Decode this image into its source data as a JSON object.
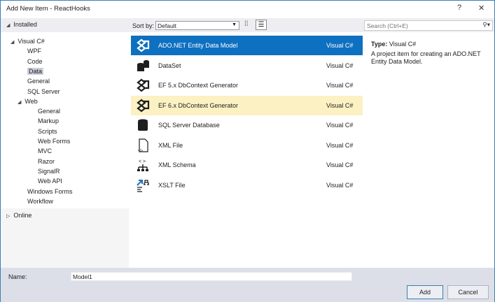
{
  "window": {
    "title": "Add New Item - ReactHooks",
    "help_label": "?",
    "close_label": "✕"
  },
  "left": {
    "installed": "Installed",
    "tree": [
      {
        "label": "Visual C#",
        "level": 1,
        "expanded": true
      },
      {
        "label": "WPF",
        "level": 2
      },
      {
        "label": "Code",
        "level": 2
      },
      {
        "label": "Data",
        "level": 2,
        "selected": true
      },
      {
        "label": "General",
        "level": 2
      },
      {
        "label": "SQL Server",
        "level": 2
      },
      {
        "label": "Web",
        "level": 2,
        "expanded": true
      },
      {
        "label": "General",
        "level": 3
      },
      {
        "label": "Markup",
        "level": 3
      },
      {
        "label": "Scripts",
        "level": 3
      },
      {
        "label": "Web Forms",
        "level": 3
      },
      {
        "label": "MVC",
        "level": 3
      },
      {
        "label": "Razor",
        "level": 3
      },
      {
        "label": "SignalR",
        "level": 3
      },
      {
        "label": "Web API",
        "level": 3
      },
      {
        "label": "Windows Forms",
        "level": 2
      },
      {
        "label": "Workflow",
        "level": 2
      }
    ],
    "online": "Online"
  },
  "toolbar": {
    "sort_label": "Sort by:",
    "sort_value": "Default",
    "search_placeholder": "Search (Ctrl+E)"
  },
  "items": [
    {
      "name": "ADO.NET Entity Data Model",
      "lang": "Visual C#",
      "icon": "entity-model-icon",
      "state": "active"
    },
    {
      "name": "DataSet",
      "lang": "Visual C#",
      "icon": "dataset-icon",
      "state": ""
    },
    {
      "name": "EF 5.x DbContext Generator",
      "lang": "Visual C#",
      "icon": "entity-model-icon",
      "state": ""
    },
    {
      "name": "EF 6.x DbContext Generator",
      "lang": "Visual C#",
      "icon": "entity-model-icon",
      "state": "hover"
    },
    {
      "name": "SQL Server Database",
      "lang": "Visual C#",
      "icon": "database-icon",
      "state": ""
    },
    {
      "name": "XML File",
      "lang": "Visual C#",
      "icon": "xml-file-icon",
      "state": ""
    },
    {
      "name": "XML Schema",
      "lang": "Visual C#",
      "icon": "xml-schema-icon",
      "state": ""
    },
    {
      "name": "XSLT File",
      "lang": "Visual C#",
      "icon": "xslt-file-icon",
      "state": ""
    }
  ],
  "details": {
    "type_label": "Type:",
    "type_value": "Visual C#",
    "description": "A project item for creating an ADO.NET Entity Data Model."
  },
  "footer": {
    "name_label": "Name:",
    "name_value": "Model1",
    "add_label": "Add",
    "cancel_label": "Cancel"
  }
}
